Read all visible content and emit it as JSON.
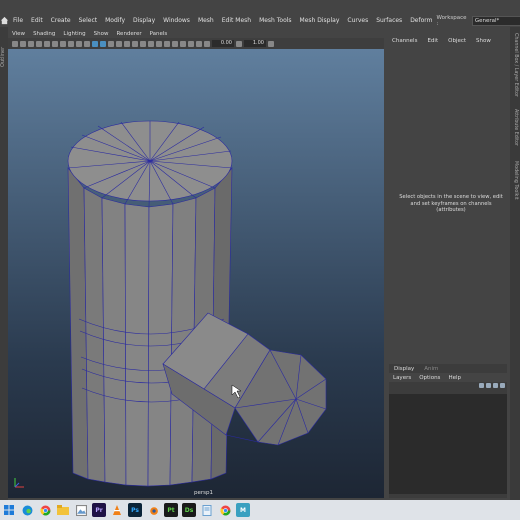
{
  "menubar": {
    "items": [
      "File",
      "Edit",
      "Create",
      "Select",
      "Modify",
      "Display",
      "Windows",
      "Mesh",
      "Edit Mesh",
      "Mesh Tools",
      "Mesh Display",
      "Curves",
      "Surfaces",
      "Deform"
    ],
    "workspace_label": "Workspace :",
    "workspace_value": "General*"
  },
  "leftstrip_label": "Outliner",
  "viewport": {
    "menu": [
      "View",
      "Shading",
      "Lighting",
      "Show",
      "Renderer",
      "Panels"
    ],
    "toolbar_value1": "0.00",
    "toolbar_value2": "1.00",
    "camera_label": "persp1"
  },
  "channel_box": {
    "tabs": [
      "Channels",
      "Edit",
      "Object",
      "Show"
    ],
    "empty_message": "Select objects in the scene to view, edit and set keyframes on channels (attributes)"
  },
  "layer_editor": {
    "tabs": [
      "Display",
      "Anim"
    ],
    "menu": [
      "Layers",
      "Options",
      "Help"
    ]
  },
  "side_tabs": [
    "Channel Box / Layer Editor",
    "Attribute Editor",
    "Modeling Toolkit"
  ],
  "taskbar": {
    "icons": [
      "windows-start-icon",
      "edge-icon",
      "chrome-icon",
      "explorer-icon",
      "photos-icon",
      "premiere-icon",
      "vlc-icon",
      "photoshop-icon",
      "blender-icon",
      "pt-icon",
      "ds-icon",
      "notepad-icon",
      "chrome-icon",
      "maya-icon"
    ],
    "labels": {
      "premiere": "Pr",
      "photoshop": "Ps",
      "pt": "Pt",
      "ds": "Ds",
      "maya": "M"
    }
  },
  "colors": {
    "ui_bg": "#444444",
    "viewport_top": "#607f9e",
    "viewport_bottom": "#1d2634",
    "wire": "#2a2aa0",
    "maya_accent": "#3aa0c0"
  }
}
